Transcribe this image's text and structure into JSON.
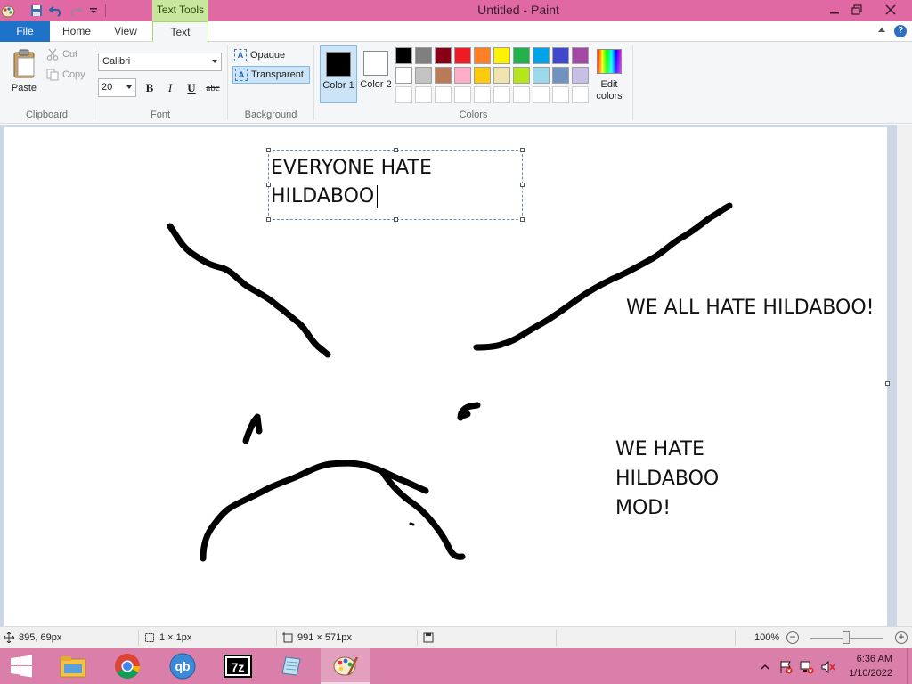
{
  "window": {
    "title": "Untitled - Paint",
    "context_tab": "Text Tools",
    "controls": {
      "minimize": "–",
      "restore": "❐",
      "close": "✕"
    }
  },
  "tabs": [
    {
      "label": "File"
    },
    {
      "label": "Home"
    },
    {
      "label": "View"
    },
    {
      "label": "Text"
    }
  ],
  "help_label": "?",
  "ribbon": {
    "clipboard": {
      "group_label": "Clipboard",
      "paste": "Paste",
      "cut": "Cut",
      "copy": "Copy"
    },
    "font": {
      "group_label": "Font",
      "family": "Calibri",
      "size": "20",
      "bold": "B",
      "italic": "I",
      "underline": "U",
      "strikethrough": "abc"
    },
    "background": {
      "group_label": "Background",
      "opaque": "Opaque",
      "transparent": "Transparent",
      "selected": "Transparent"
    },
    "colors": {
      "group_label": "Colors",
      "color1_label": "Color 1",
      "color2_label": "Color 2",
      "color1": "#000000",
      "color2": "#ffffff",
      "edit_colors": "Edit colors",
      "palette_row1": [
        "#000000",
        "#7f7f7f",
        "#880015",
        "#ed1c24",
        "#ff7f27",
        "#fff200",
        "#22b14c",
        "#00a2e8",
        "#3f48cc",
        "#a349a4"
      ],
      "palette_row2": [
        "#ffffff",
        "#c3c3c3",
        "#b97a57",
        "#ffaec9",
        "#ffc90e",
        "#efe4b0",
        "#b5e61d",
        "#99d9ea",
        "#7092be",
        "#c8bfe7"
      ]
    }
  },
  "canvas": {
    "textbox_lines": [
      "EVERYONE HATE",
      "HILDABOO"
    ],
    "text_right_top": "WE ALL HATE HILDABOO!",
    "text_right_bottom": [
      "WE HATE",
      "HILDABOO",
      "MOD!"
    ],
    "ink_color": "#000000"
  },
  "statusbar": {
    "cursor_pos": "895, 69px",
    "selection_size": "1 × 1px",
    "canvas_size": "991 × 571px",
    "zoom": "100%"
  },
  "taskbar": {
    "apps": [
      "windows-start",
      "file-explorer",
      "chrome",
      "qbittorrent",
      "7-zip",
      "notepad",
      "paint"
    ],
    "time": "6:36 AM",
    "date": "1/10/2022"
  }
}
